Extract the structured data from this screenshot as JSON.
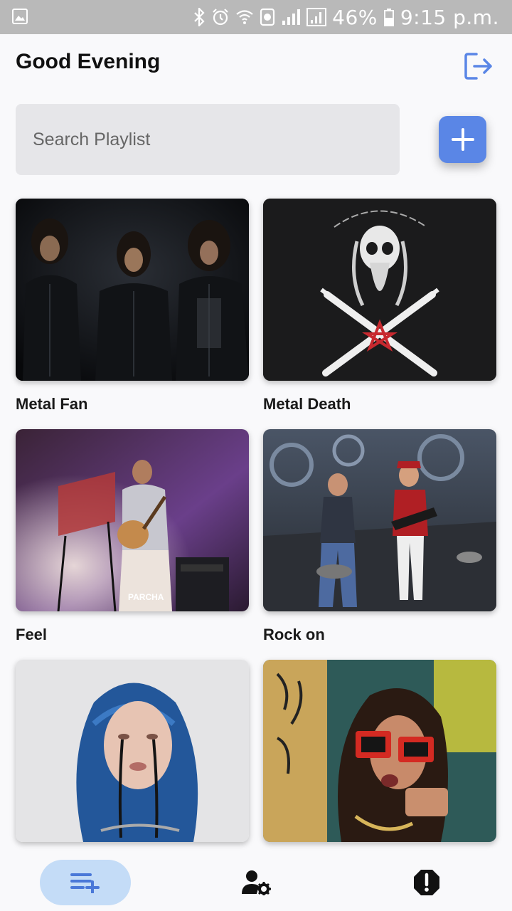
{
  "status_bar": {
    "battery_percent": "46%",
    "time": "9:15 p.m."
  },
  "header": {
    "title": "Good Evening",
    "logout_icon": "logout-icon"
  },
  "search": {
    "placeholder": "Search Playlist",
    "value": ""
  },
  "add_button_icon": "plus-icon",
  "playlists": [
    {
      "name": "Metal Fan"
    },
    {
      "name": "Metal Death"
    },
    {
      "name": "Feel"
    },
    {
      "name": "Rock on"
    },
    {
      "name": ""
    },
    {
      "name": ""
    }
  ],
  "bottom_nav": {
    "items": [
      "playlist-add-icon",
      "user-settings-icon",
      "alert-icon"
    ],
    "active_index": 0
  },
  "colors": {
    "accent": "#5a86e6",
    "nav_active_bg": "#c4dcf7",
    "status_bar": "#b9b9b9"
  }
}
